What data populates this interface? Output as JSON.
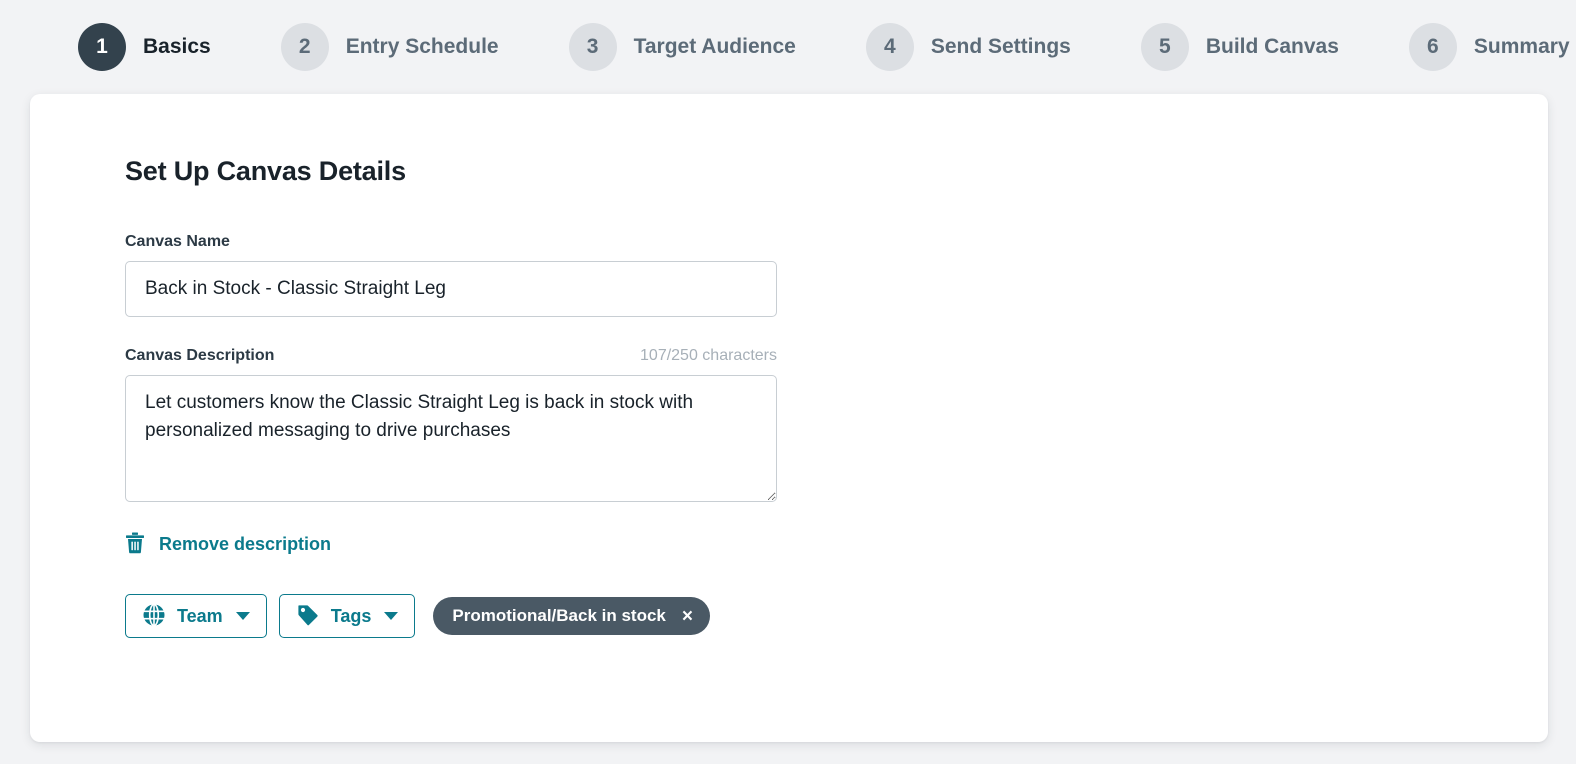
{
  "stepper": {
    "steps": [
      {
        "number": "1",
        "label": "Basics",
        "active": true
      },
      {
        "number": "2",
        "label": "Entry Schedule",
        "active": false
      },
      {
        "number": "3",
        "label": "Target Audience",
        "active": false
      },
      {
        "number": "4",
        "label": "Send Settings",
        "active": false
      },
      {
        "number": "5",
        "label": "Build Canvas",
        "active": false
      },
      {
        "number": "6",
        "label": "Summary",
        "active": false
      }
    ]
  },
  "card": {
    "title": "Set Up Canvas Details",
    "canvas_name": {
      "label": "Canvas Name",
      "value": "Back in Stock - Classic Straight Leg",
      "placeholder": "Canvas Name"
    },
    "canvas_description": {
      "label": "Canvas Description",
      "char_count": "107/250 characters",
      "value": "Let customers know the Classic Straight Leg is back in stock with personalized messaging to drive purchases",
      "placeholder": "Canvas Description"
    },
    "remove_description": {
      "label": "Remove description",
      "icon": "trash-icon"
    },
    "controls": {
      "team": {
        "label": "Team",
        "icon": "globe-icon",
        "caret": "chevron-down-icon"
      },
      "tags": {
        "label": "Tags",
        "icon": "tag-icon",
        "caret": "chevron-down-icon"
      },
      "applied_tags": [
        {
          "label": "Promotional/Back in stock",
          "close": "×"
        }
      ]
    }
  },
  "colors": {
    "accent_teal": "#0b7a8c",
    "active_step": "#33424d",
    "inactive_step": "#dcdfe3",
    "chip_bg": "#4a5965",
    "page_bg": "#f2f3f5"
  }
}
